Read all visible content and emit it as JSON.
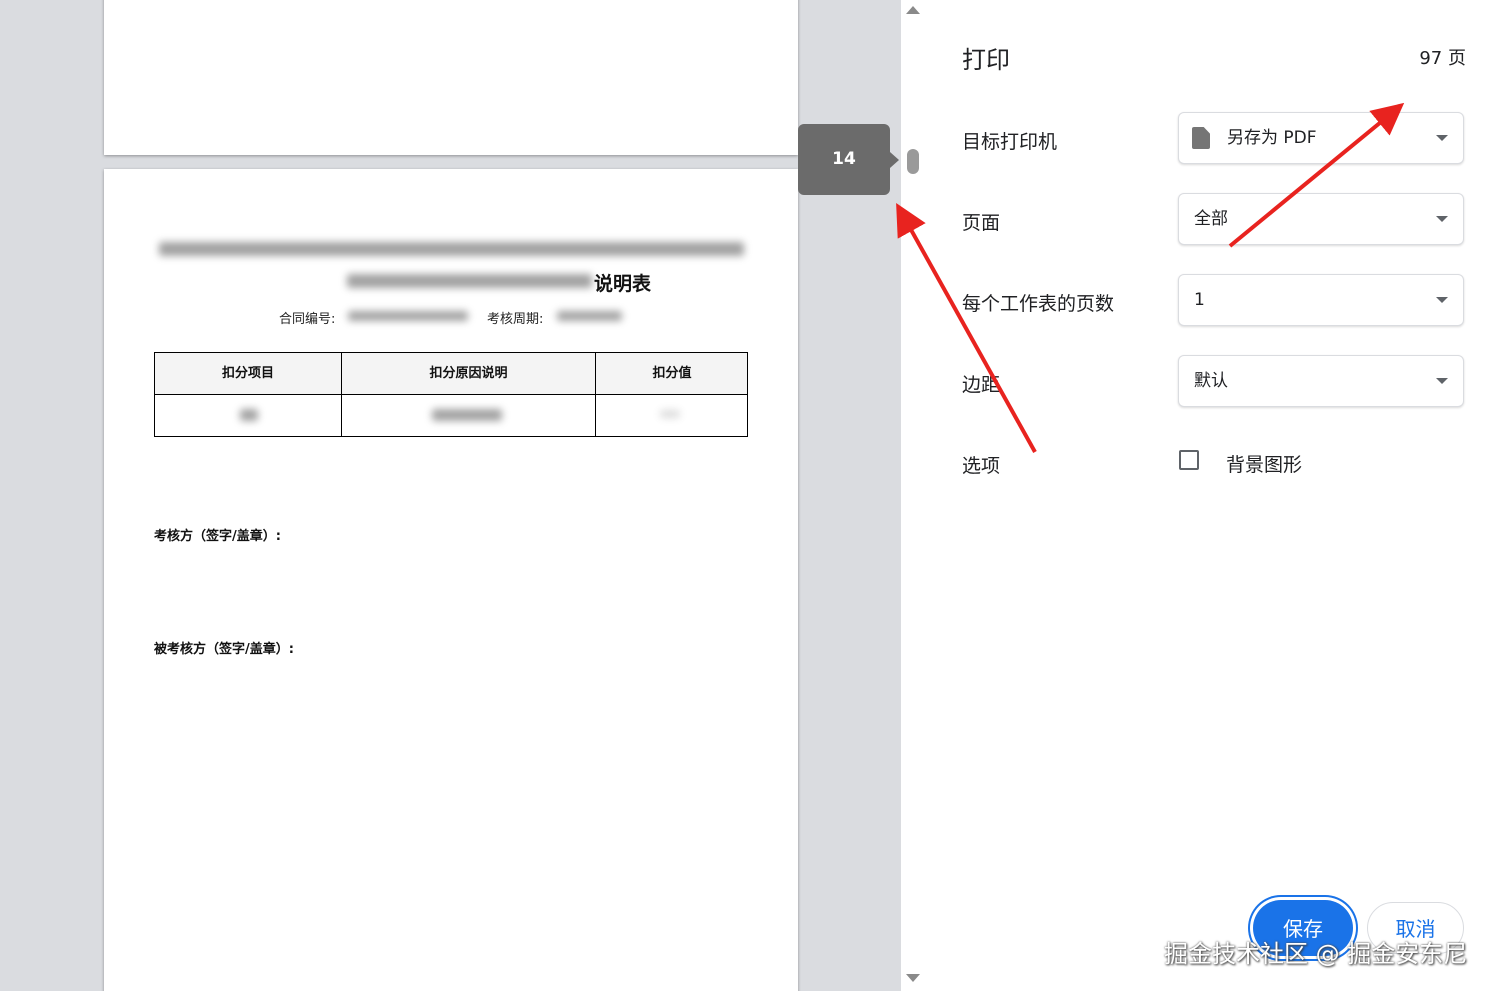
{
  "preview": {
    "page_number": "14",
    "document": {
      "title_visible_part": "说明表",
      "contract_no_label": "合同编号:",
      "period_label": "考核周期:",
      "table_headers": [
        "扣分项目",
        "扣分原因说明",
        "扣分值"
      ],
      "assessor_sign_label": "考核方（签字/盖章）:",
      "assessee_sign_label": "被考核方（签字/盖章）:"
    }
  },
  "panel": {
    "title": "打印",
    "page_count": "97 页",
    "settings": {
      "destination": {
        "label": "目标打印机",
        "value": "另存为 PDF",
        "icon": "document-icon"
      },
      "pages": {
        "label": "页面",
        "value": "全部"
      },
      "pages_per_sheet": {
        "label": "每个工作表的页数",
        "value": "1"
      },
      "margins": {
        "label": "边距",
        "value": "默认"
      },
      "options": {
        "label": "选项",
        "background_graphics": "背景图形",
        "background_graphics_checked": false
      }
    },
    "save_button": "保存",
    "cancel_button": "取消"
  },
  "watermark": "掘金技术社区 @ 掘金安东尼",
  "colors": {
    "accent": "#1a73e8",
    "arrow": "#e8231f",
    "tooltip": "#6b6b6b"
  }
}
